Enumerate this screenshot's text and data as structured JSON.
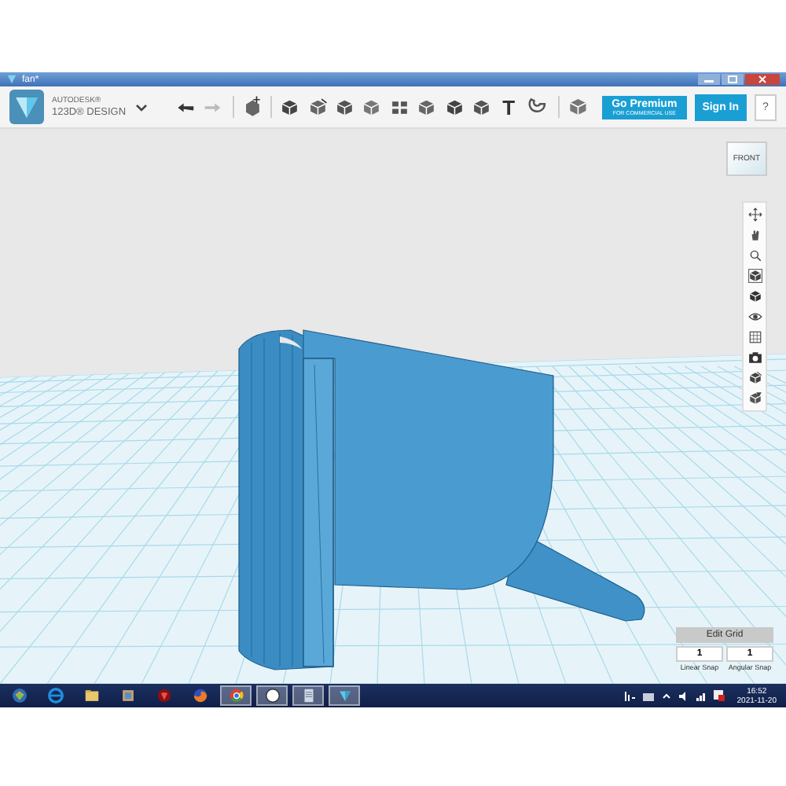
{
  "window": {
    "title": "fan*"
  },
  "toolbar": {
    "brand_top": "AUTODESK®",
    "brand_bottom": "123D® DESIGN",
    "text_tool": "T",
    "premium": {
      "label": "Go Premium",
      "sublabel": "FOR COMMERCIAL USE"
    },
    "sign_in": "Sign In",
    "help": "?"
  },
  "viewcube": {
    "face": "FRONT"
  },
  "grid_panel": {
    "title": "Edit Grid",
    "fields": [
      {
        "value": "1",
        "label": "Linear Snap"
      },
      {
        "value": "1",
        "label": "Angular Snap"
      }
    ]
  },
  "taskbar": {
    "apps": [
      {
        "kind": "start",
        "open": false
      },
      {
        "kind": "browser-e",
        "open": false
      },
      {
        "kind": "folder",
        "open": false
      },
      {
        "kind": "media",
        "open": false
      },
      {
        "kind": "shield",
        "open": false
      },
      {
        "kind": "fox",
        "open": false
      },
      {
        "kind": "chrome",
        "open": true
      },
      {
        "kind": "round",
        "open": true
      },
      {
        "kind": "notes",
        "open": true
      },
      {
        "kind": "design",
        "open": true
      }
    ],
    "time": "16:52",
    "date": "2021-11-20"
  }
}
